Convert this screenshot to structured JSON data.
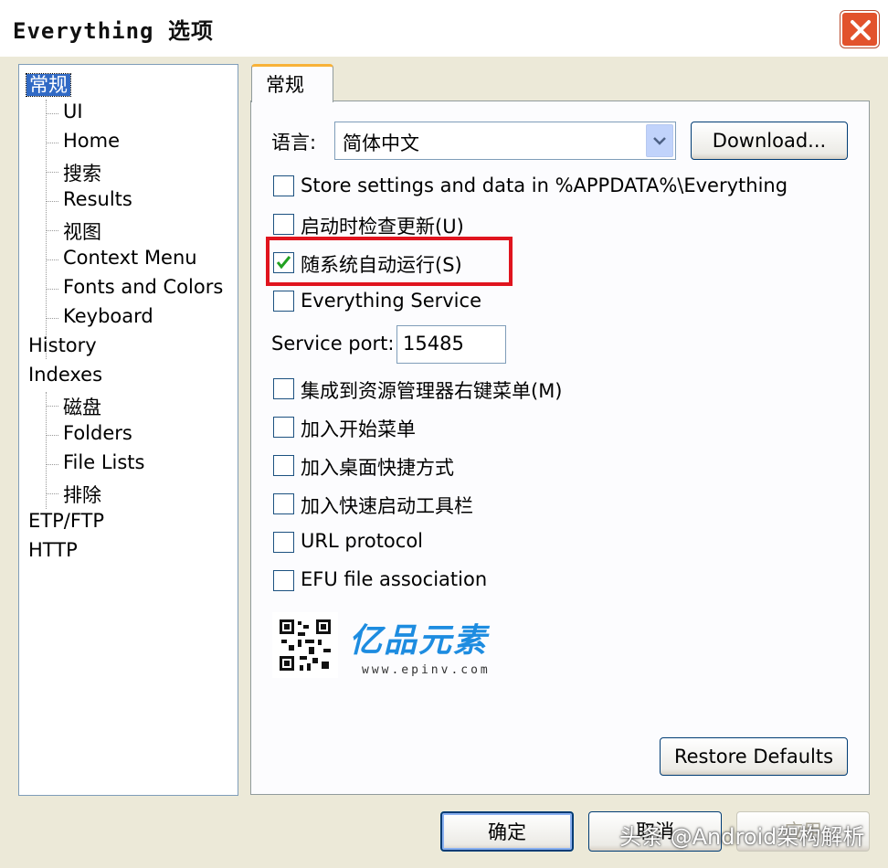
{
  "window": {
    "title": "Everything 选项"
  },
  "tree": {
    "items": [
      {
        "label": "常规",
        "level": 0,
        "selected": true
      },
      {
        "label": "UI",
        "level": 1
      },
      {
        "label": "Home",
        "level": 1
      },
      {
        "label": "搜索",
        "level": 1
      },
      {
        "label": "Results",
        "level": 1
      },
      {
        "label": "视图",
        "level": 1
      },
      {
        "label": "Context Menu",
        "level": 1
      },
      {
        "label": "Fonts and Colors",
        "level": 1
      },
      {
        "label": "Keyboard",
        "level": 1
      },
      {
        "label": "History",
        "level": 0
      },
      {
        "label": "Indexes",
        "level": 0
      },
      {
        "label": "磁盘",
        "level": 1
      },
      {
        "label": "Folders",
        "level": 1
      },
      {
        "label": "File Lists",
        "level": 1
      },
      {
        "label": "排除",
        "level": 1
      },
      {
        "label": "ETP/FTP",
        "level": 0
      },
      {
        "label": "HTTP",
        "level": 0
      }
    ]
  },
  "tab": {
    "label": "常规"
  },
  "language": {
    "label": "语言:",
    "value": "简体中文",
    "download_button": "Download..."
  },
  "options": [
    {
      "label": "Store settings and data in %APPDATA%\\Everything",
      "checked": false
    },
    {
      "label": "启动时检查更新(U)",
      "checked": false
    },
    {
      "label": "随系统自动运行(S)",
      "checked": true
    },
    {
      "label": "Everything Service",
      "checked": false
    }
  ],
  "service_port": {
    "label": "Service port:",
    "value": "15485"
  },
  "integration_options": [
    {
      "label": "集成到资源管理器右键菜单(M)",
      "checked": false
    },
    {
      "label": "加入开始菜单",
      "checked": false
    },
    {
      "label": "加入桌面快捷方式",
      "checked": false
    },
    {
      "label": "加入快速启动工具栏",
      "checked": false
    },
    {
      "label": "URL protocol",
      "checked": false
    },
    {
      "label": "EFU file association",
      "checked": false
    }
  ],
  "logo": {
    "name": "亿品元素",
    "url": "www.epinv.com"
  },
  "buttons": {
    "restore_defaults": "Restore Defaults",
    "ok": "确定",
    "cancel": "取消",
    "apply": "应用"
  },
  "watermark": "头条 @Android架构解析"
}
